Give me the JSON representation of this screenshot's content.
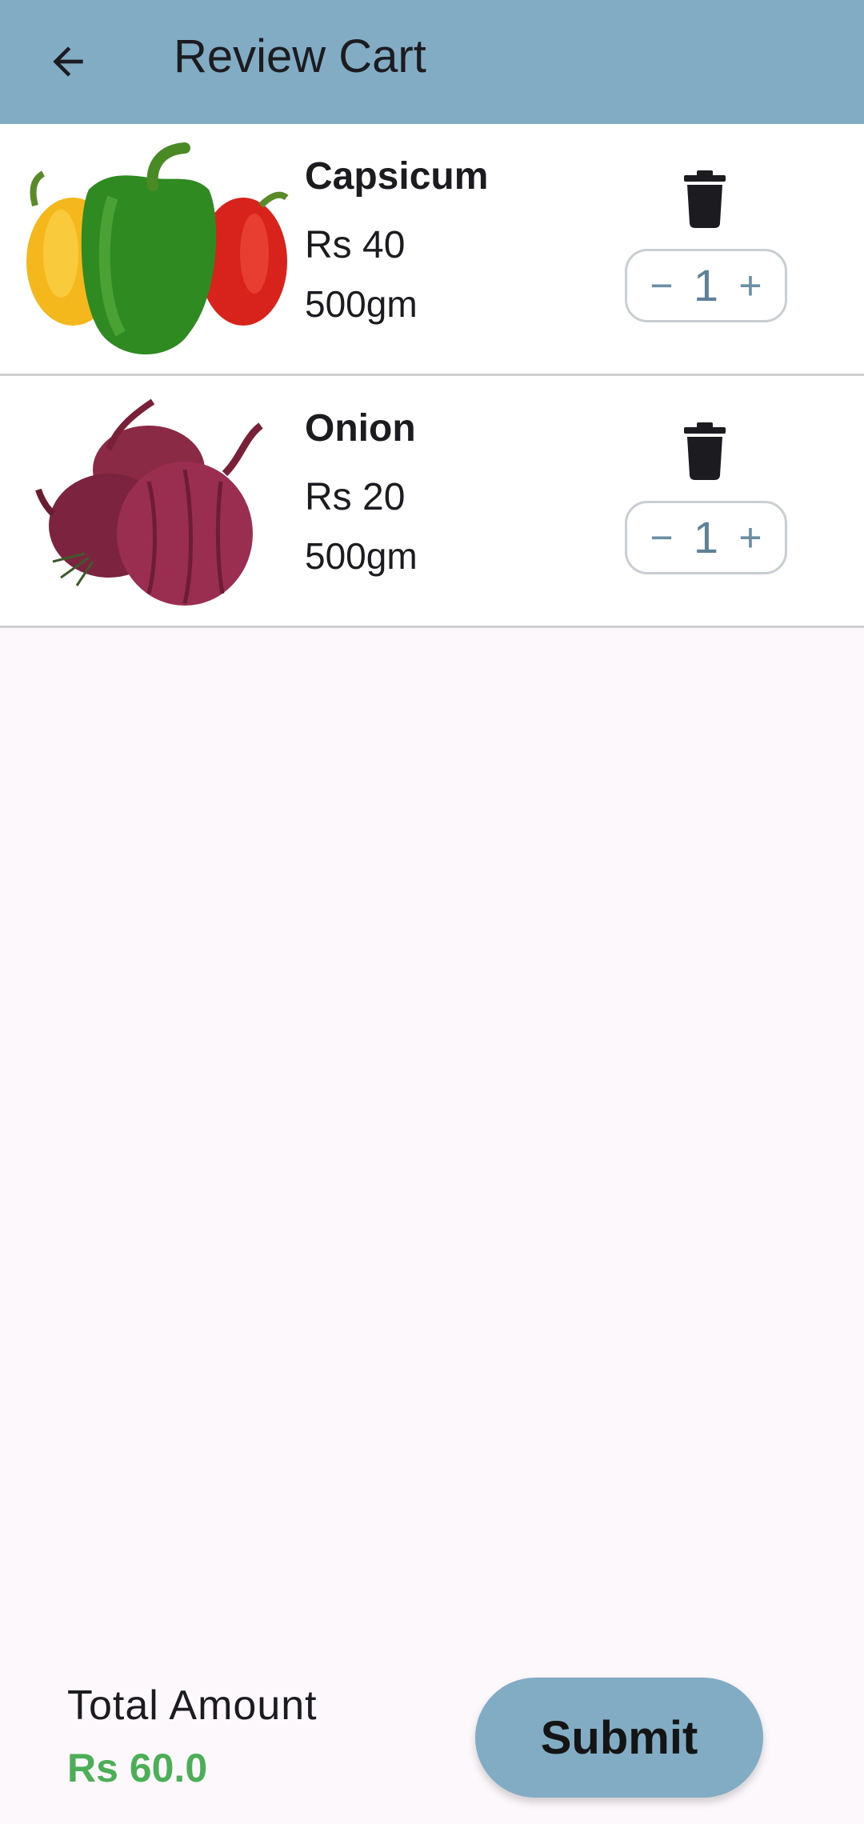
{
  "appbar": {
    "title": "Review Cart",
    "back_icon": "arrow-left-icon",
    "background": "#81acc4"
  },
  "cart": {
    "items": [
      {
        "name": "Capsicum",
        "price": "Rs 40",
        "weight": "500gm",
        "quantity": "1",
        "image_icon": "capsicum-image",
        "delete_icon": "trash-icon",
        "decrement_label": "−",
        "increment_label": "+"
      },
      {
        "name": "Onion",
        "price": "Rs 20",
        "weight": "500gm",
        "quantity": "1",
        "image_icon": "onion-image",
        "delete_icon": "trash-icon",
        "decrement_label": "−",
        "increment_label": "+"
      }
    ]
  },
  "footer": {
    "total_label": "Total Amount",
    "total_value": "Rs 60.0",
    "total_color": "#4cae56",
    "submit_label": "Submit"
  }
}
